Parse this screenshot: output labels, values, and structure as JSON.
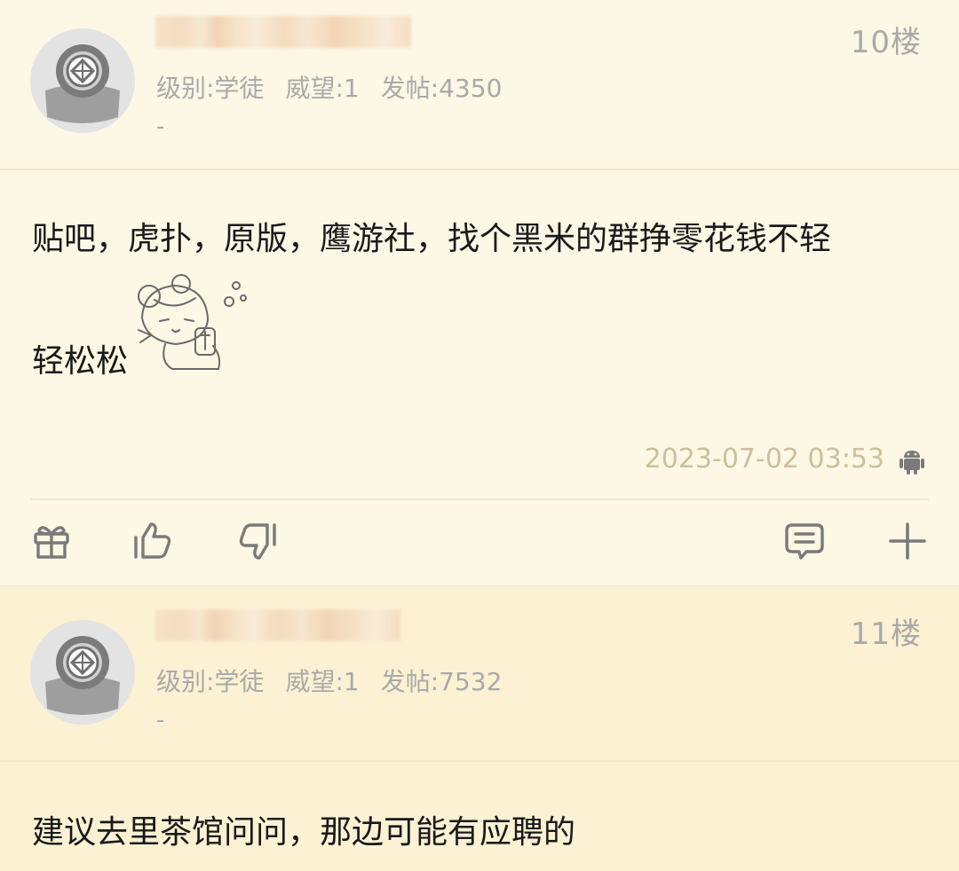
{
  "posts": [
    {
      "floor": "10楼",
      "level": "级别:学徒",
      "prestige": "威望:1",
      "posts_count": "发帖:4350",
      "signature": "-",
      "content_line1": "贴吧，虎扑，原版，鹰游社，找个黑米的群挣零花钱不轻",
      "content_line2": "轻松松",
      "timestamp": "2023-07-02 03:53"
    },
    {
      "floor": "11楼",
      "level": "级别:学徒",
      "prestige": "威望:1",
      "posts_count": "发帖:7532",
      "signature": "-",
      "content_line1": "建议去里茶馆问问，那边可能有应聘的"
    }
  ],
  "icons": {
    "gift": "gift-icon",
    "like": "thumbs-up-icon",
    "dislike": "thumbs-down-icon",
    "comment": "comment-icon",
    "more": "plus-icon",
    "device": "android-icon"
  },
  "colors": {
    "background": "#fdf7e5",
    "highlight_background": "#fcf1d3",
    "meta_text": "#a9a9a9",
    "timestamp_text": "#cdbf9c"
  }
}
